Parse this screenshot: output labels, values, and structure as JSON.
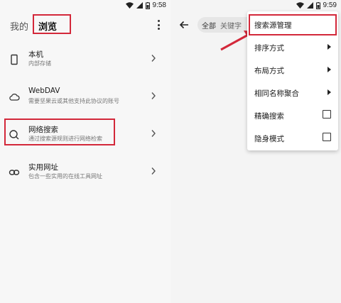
{
  "left": {
    "status": {
      "time": "9:58"
    },
    "tabs": {
      "mine": "我的",
      "browse": "浏览"
    },
    "items": [
      {
        "title": "本机",
        "subtitle": "内部存储",
        "icon": "phone-icon"
      },
      {
        "title": "WebDAV",
        "subtitle": "需要坚果云或其他支持此协议的账号",
        "icon": "cloud-icon"
      },
      {
        "title": "网络搜索",
        "subtitle": "通过搜索源规则进行网络检索",
        "icon": "search-icon"
      },
      {
        "title": "实用网址",
        "subtitle": "包含一些实用的在线工具网址",
        "icon": "link-icon"
      }
    ]
  },
  "right": {
    "status": {
      "time": "9:59"
    },
    "chips": {
      "all": "全部",
      "keyword": "关键字"
    },
    "menu": [
      {
        "label": "搜索源管理",
        "type": "plain"
      },
      {
        "label": "排序方式",
        "type": "submenu"
      },
      {
        "label": "布局方式",
        "type": "submenu"
      },
      {
        "label": "相同名称聚合",
        "type": "submenu"
      },
      {
        "label": "精确搜索",
        "type": "checkbox",
        "checked": false
      },
      {
        "label": "隐身模式",
        "type": "checkbox",
        "checked": false
      }
    ]
  },
  "colors": {
    "highlight": "#d3283a",
    "arrow": "#d3283a"
  }
}
